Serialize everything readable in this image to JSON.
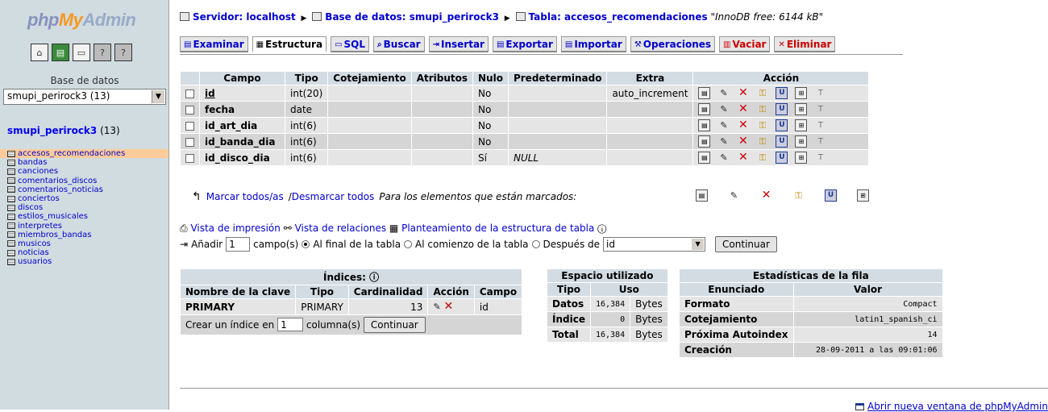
{
  "left": {
    "logo": {
      "php": "php",
      "my": "My",
      "admin": "Admin"
    },
    "icons": [
      "home-icon",
      "query-window-icon",
      "sql-icon",
      "docs-icon",
      "help-icon"
    ],
    "db_label": "Base de datos",
    "db_selected": "smupi_perirock3 (13)",
    "db_name": "smupi_perirock3",
    "db_count": "(13)",
    "tables": [
      "accesos_recomendaciones",
      "bandas",
      "canciones",
      "comentarios_discos",
      "comentarios_noticias",
      "conciertos",
      "discos",
      "estilos_musicales",
      "interpretes",
      "miembros_bandas",
      "musicos",
      "noticias",
      "usuarios"
    ]
  },
  "crumbs": {
    "server": "Servidor: localhost",
    "database": "Base de datos: smupi_perirock3",
    "table": "Tabla: accesos_recomendaciones",
    "note": "\"InnoDB free: 6144 kB\""
  },
  "tabs": [
    "Examinar",
    "Estructura",
    "SQL",
    "Buscar",
    "Insertar",
    "Exportar",
    "Importar",
    "Operaciones",
    "Vaciar",
    "Eliminar"
  ],
  "structure": {
    "headers": [
      "Campo",
      "Tipo",
      "Cotejamiento",
      "Atributos",
      "Nulo",
      "Predeterminado",
      "Extra",
      "Acción"
    ],
    "rows": [
      {
        "campo": "id",
        "tipo": "int(20)",
        "cotej": "",
        "attr": "",
        "nulo": "No",
        "pred": "",
        "extra": "auto_increment"
      },
      {
        "campo": "fecha",
        "tipo": "date",
        "cotej": "",
        "attr": "",
        "nulo": "No",
        "pred": "",
        "extra": ""
      },
      {
        "campo": "id_art_dia",
        "tipo": "int(6)",
        "cotej": "",
        "attr": "",
        "nulo": "No",
        "pred": "",
        "extra": ""
      },
      {
        "campo": "id_banda_dia",
        "tipo": "int(6)",
        "cotej": "",
        "attr": "",
        "nulo": "No",
        "pred": "",
        "extra": ""
      },
      {
        "campo": "id_disco_dia",
        "tipo": "int(6)",
        "cotej": "",
        "attr": "",
        "nulo": "Sí",
        "pred": "NULL",
        "extra": ""
      }
    ]
  },
  "mark": {
    "check_all": "Marcar todos/as",
    "sep": " / ",
    "uncheck_all": "Desmarcar todos",
    "for_selected": "Para los elementos que están marcados:"
  },
  "links": {
    "print": "Vista de impresión",
    "relations": "Vista de relaciones",
    "propose": "Planteamiento de la estructura de tabla"
  },
  "add": {
    "label": "Añadir",
    "count": "1",
    "fields_label": "campo(s)",
    "opt_end": "Al final de la tabla",
    "opt_begin": "Al comienzo de la tabla",
    "opt_after": "Después de",
    "after_field": "id",
    "submit": "Continuar"
  },
  "indexes": {
    "title": "Índices:",
    "headers": [
      "Nombre de la clave",
      "Tipo",
      "Cardinalidad",
      "Acción",
      "Campo"
    ],
    "rows": [
      {
        "name": "PRIMARY",
        "type": "PRIMARY",
        "card": "13",
        "field": "id"
      }
    ],
    "create_label": "Crear un índice en",
    "create_count": "1",
    "create_cols": "columna(s)",
    "create_submit": "Continuar"
  },
  "space": {
    "title": "Espacio utilizado",
    "headers": [
      "Tipo",
      "Uso"
    ],
    "rows": [
      {
        "tipo": "Datos",
        "uso": "16,384",
        "unit": "Bytes"
      },
      {
        "tipo": "Índice",
        "uso": "0",
        "unit": "Bytes"
      },
      {
        "tipo": "Total",
        "uso": "16,384",
        "unit": "Bytes"
      }
    ]
  },
  "stats": {
    "title": "Estadísticas de la fila",
    "headers": [
      "Enunciado",
      "Valor"
    ],
    "rows": [
      {
        "k": "Formato",
        "v": "Compact"
      },
      {
        "k": "Cotejamiento",
        "v": "latin1_spanish_ci"
      },
      {
        "k": "Próxima Autoindex",
        "v": "14"
      },
      {
        "k": "Creación",
        "v": "28-09-2011 a las 09:01:06"
      }
    ]
  },
  "footer": {
    "new_window": "Abrir nueva ventana de phpMyAdmin"
  }
}
